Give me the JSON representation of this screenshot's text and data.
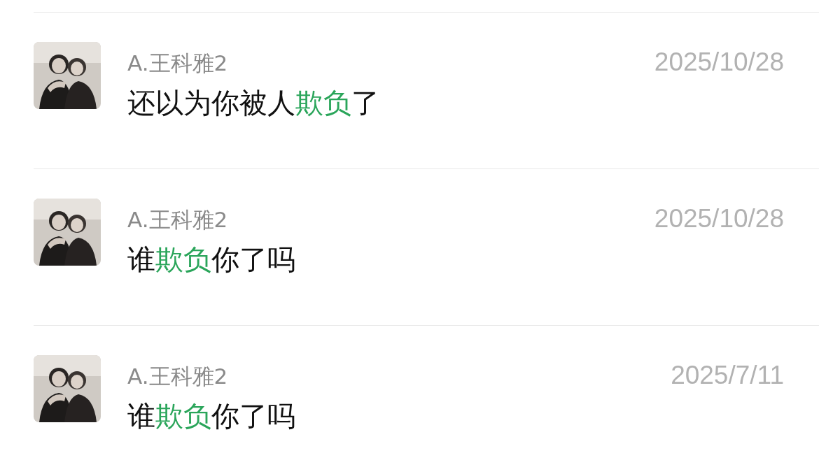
{
  "results": [
    {
      "name": "A.王科雅2",
      "date": "2025/10/28",
      "message": [
        {
          "text": "还以为你被人",
          "highlight": false
        },
        {
          "text": "欺负",
          "highlight": true
        },
        {
          "text": "了",
          "highlight": false
        }
      ]
    },
    {
      "name": "A.王科雅2",
      "date": "2025/10/28",
      "message": [
        {
          "text": "谁",
          "highlight": false
        },
        {
          "text": "欺负",
          "highlight": true
        },
        {
          "text": "你了吗",
          "highlight": false
        }
      ]
    },
    {
      "name": "A.王科雅2",
      "date": "2025/7/11",
      "message": [
        {
          "text": "谁",
          "highlight": false
        },
        {
          "text": "欺负",
          "highlight": true
        },
        {
          "text": "你了吗",
          "highlight": false
        }
      ]
    }
  ]
}
